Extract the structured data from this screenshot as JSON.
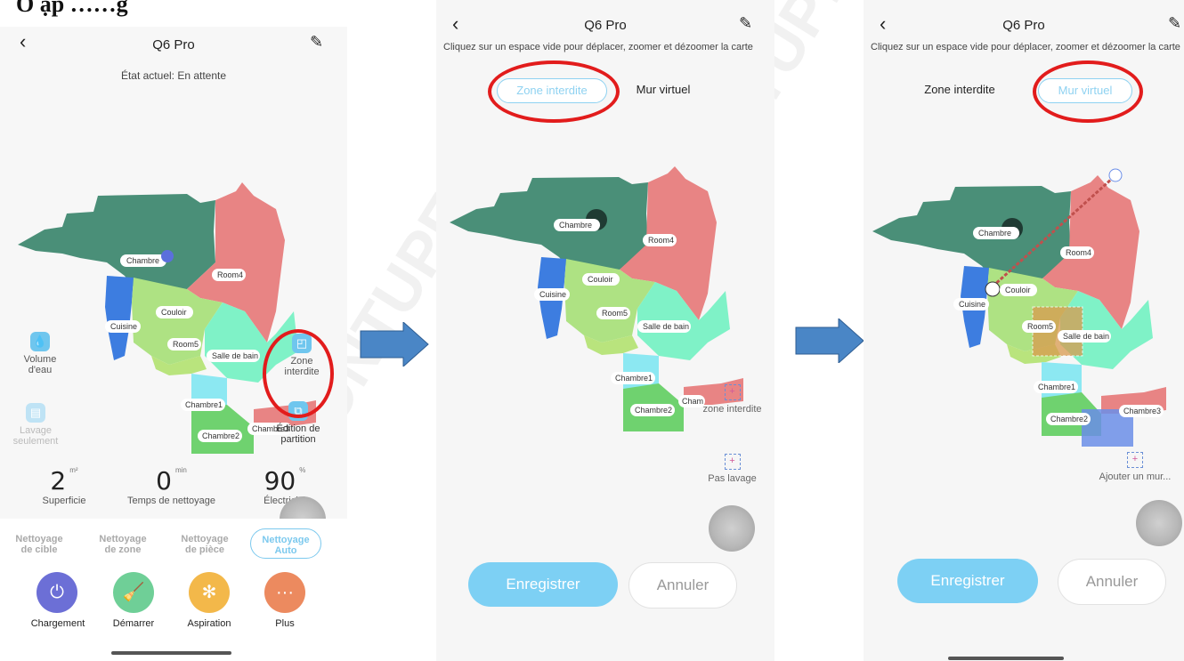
{
  "heading": "Ô ặp         ……g",
  "watermark": "HONTUPE",
  "colors": {
    "accent": "#7cc9ee",
    "ring": "#e21c1c",
    "arrow": "#4a86c6"
  },
  "phone1": {
    "title": "Q6 Pro",
    "status": "État actuel: En attente",
    "rooms": {
      "chambre": "Chambre",
      "room4": "Room4",
      "couloir": "Couloir",
      "cuisine": "Cuisine",
      "room5": "Room5",
      "salle_de_bain": "Salle de bain",
      "chambre1": "Chambre1",
      "chambre2": "Chambre2",
      "chambre3": "Chambre3"
    },
    "side": {
      "water": "Volume\nd'eau",
      "wash_only": "Lavage\nseulement",
      "zone": "Zone\ninterdite",
      "partition": "Édition de\npartition"
    },
    "stats": [
      {
        "value": "2",
        "unit": "m²",
        "label": "Superficie"
      },
      {
        "value": "0",
        "unit": "min",
        "label": "Temps de nettoyage"
      },
      {
        "value": "90",
        "unit": "%",
        "label": "Électricité"
      }
    ],
    "modes": [
      "Nettoyage\nde cible",
      "Nettoyage\nde zone",
      "Nettoyage\nde pièce",
      "Nettoyage\nAuto"
    ],
    "actions": [
      "Chargement",
      "Démarrer",
      "Aspiration",
      "Plus"
    ],
    "action_colors": [
      "#6c6fd6",
      "#6fcf97",
      "#f3b84a",
      "#ec8a5f"
    ]
  },
  "phone2": {
    "title": "Q6 Pro",
    "hint": "Cliquez sur un espace vide pour déplacer, zoomer et dézoomer la carte",
    "tab_zone": "Zone interdite",
    "tab_wall": "Mur virtuel",
    "tool_zone": "zone interdite",
    "tool_nowash": "Pas lavage",
    "room_cham": "Cham",
    "save": "Enregistrer",
    "cancel": "Annuler"
  },
  "phone3": {
    "title": "Q6 Pro",
    "hint": "Cliquez sur un espace vide pour déplacer, zoomer et dézoomer la carte",
    "tab_zone": "Zone interdite",
    "tab_wall": "Mur virtuel",
    "tool_wall": "Ajouter un mur...",
    "save": "Enregistrer",
    "cancel": "Annuler"
  }
}
